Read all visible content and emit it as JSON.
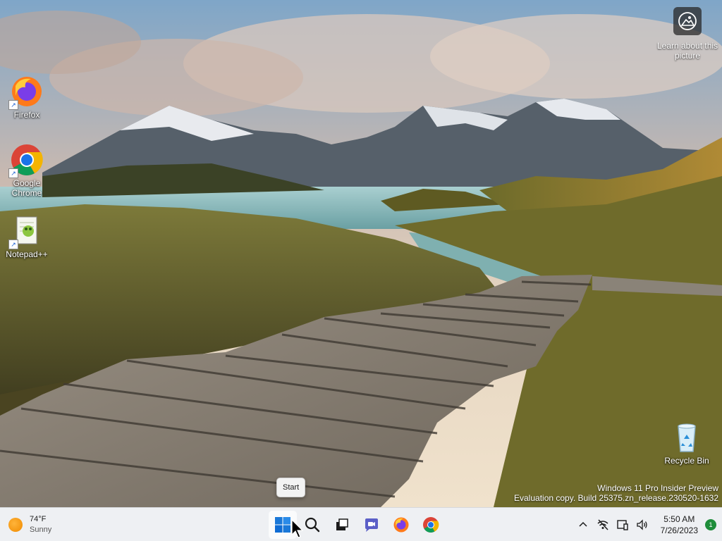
{
  "desktop": {
    "icons": [
      {
        "label": "Firefox",
        "icon": "firefox-icon"
      },
      {
        "label": "Google Chrome",
        "icon": "chrome-icon"
      },
      {
        "label": "Notepad++",
        "icon": "notepad-plus-plus-icon"
      },
      {
        "label": "Recycle Bin",
        "icon": "recycle-bin-icon"
      }
    ],
    "learn_picture": {
      "label": "Learn about this picture",
      "icon": "camera-icon"
    },
    "watermark": {
      "line1": "Windows 11 Pro Insider Preview",
      "line2": "Evaluation copy. Build 25375.zn_release.230520-1632"
    },
    "start_tooltip": "Start"
  },
  "taskbar": {
    "weather": {
      "temp": "74°F",
      "condition": "Sunny",
      "icon": "sun-icon"
    },
    "apps": [
      {
        "name": "Start",
        "icon": "windows-logo-icon",
        "active": true
      },
      {
        "name": "Search",
        "icon": "search-icon"
      },
      {
        "name": "Task View",
        "icon": "task-view-icon"
      },
      {
        "name": "Chat",
        "icon": "chat-icon"
      },
      {
        "name": "Firefox",
        "icon": "firefox-icon"
      },
      {
        "name": "Google Chrome",
        "icon": "chrome-icon"
      }
    ],
    "tray": {
      "icons": [
        "chevron-up-icon",
        "network-off-icon",
        "tablet-device-icon",
        "volume-icon"
      ],
      "time": "5:50 AM",
      "date": "7/26/2023",
      "notification_count": "1"
    }
  },
  "colors": {
    "taskbar_bg": "#eef0f3",
    "windows_blue": "#0f6cd4",
    "notification_green": "#1e8d3a"
  }
}
